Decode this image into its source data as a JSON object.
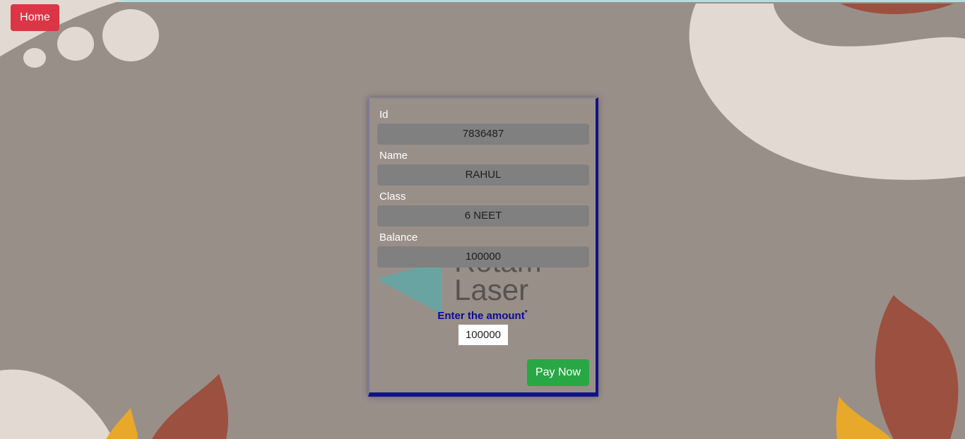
{
  "nav": {
    "home_label": "Home"
  },
  "form": {
    "fields": [
      {
        "label": "Id",
        "value": "7836487"
      },
      {
        "label": "Name",
        "value": "RAHUL"
      },
      {
        "label": "Class",
        "value": "6 NEET"
      },
      {
        "label": "Balance",
        "value": "100000"
      }
    ],
    "amount_label": "Enter the amount",
    "required_marker": "*",
    "amount_value": "100000",
    "pay_label": "Pay Now",
    "watermark_text": [
      "Rotam",
      "Laser"
    ]
  },
  "colors": {
    "background": "#998f89",
    "home_button": "#dc3545",
    "pay_button": "#28a745",
    "amount_label": "#0a0a9a",
    "card_border": "#12128c"
  }
}
